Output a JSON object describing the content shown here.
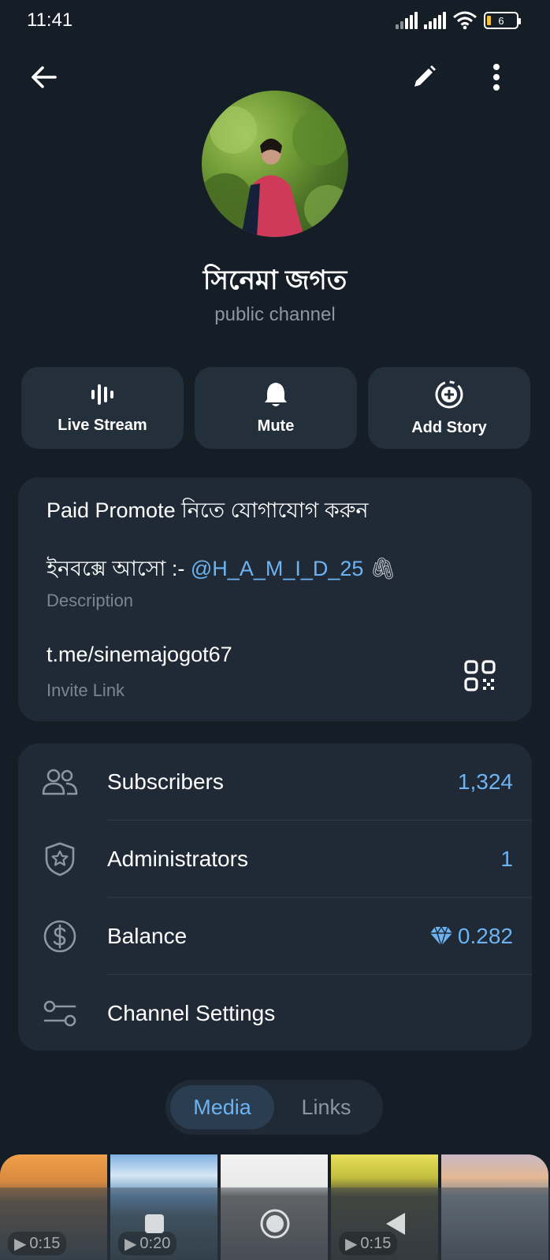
{
  "status_bar": {
    "time": "11:41",
    "battery": "6"
  },
  "channel": {
    "name": "সিনেমা জগত",
    "type": "public channel"
  },
  "actions": [
    {
      "label": "Live Stream",
      "icon": "live-stream-icon"
    },
    {
      "label": "Mute",
      "icon": "bell-icon"
    },
    {
      "label": "Add Story",
      "icon": "add-story-icon"
    }
  ],
  "info": {
    "description_line1": "Paid Promote নিতে যোগাযোগ করুন",
    "description_line2_prefix": "ইনবক্সে আসো :- ",
    "description_mention": "@H_A_M_I_D_25",
    "description_emoji": "🖇",
    "description_label": "Description",
    "invite_link": "t.me/sinemajogot67",
    "invite_label": "Invite Link"
  },
  "rows": [
    {
      "label": "Subscribers",
      "value": "1,324",
      "icon": "users-icon"
    },
    {
      "label": "Administrators",
      "value": "1",
      "icon": "shield-star-icon"
    },
    {
      "label": "Balance",
      "value": "0.282",
      "icon": "dollar-circle-icon"
    },
    {
      "label": "Channel Settings",
      "value": "",
      "icon": "settings-sliders-icon"
    }
  ],
  "tabs": {
    "media": "Media",
    "links": "Links"
  },
  "media": [
    {
      "duration": "0:15"
    },
    {
      "duration": "0:20"
    },
    {
      "duration": ""
    },
    {
      "duration": "0:15"
    },
    {
      "duration": ""
    }
  ],
  "colors": {
    "background": "#151d27",
    "card": "#1f2a36",
    "accent": "#6db3f2",
    "muted": "#8c96a1"
  }
}
